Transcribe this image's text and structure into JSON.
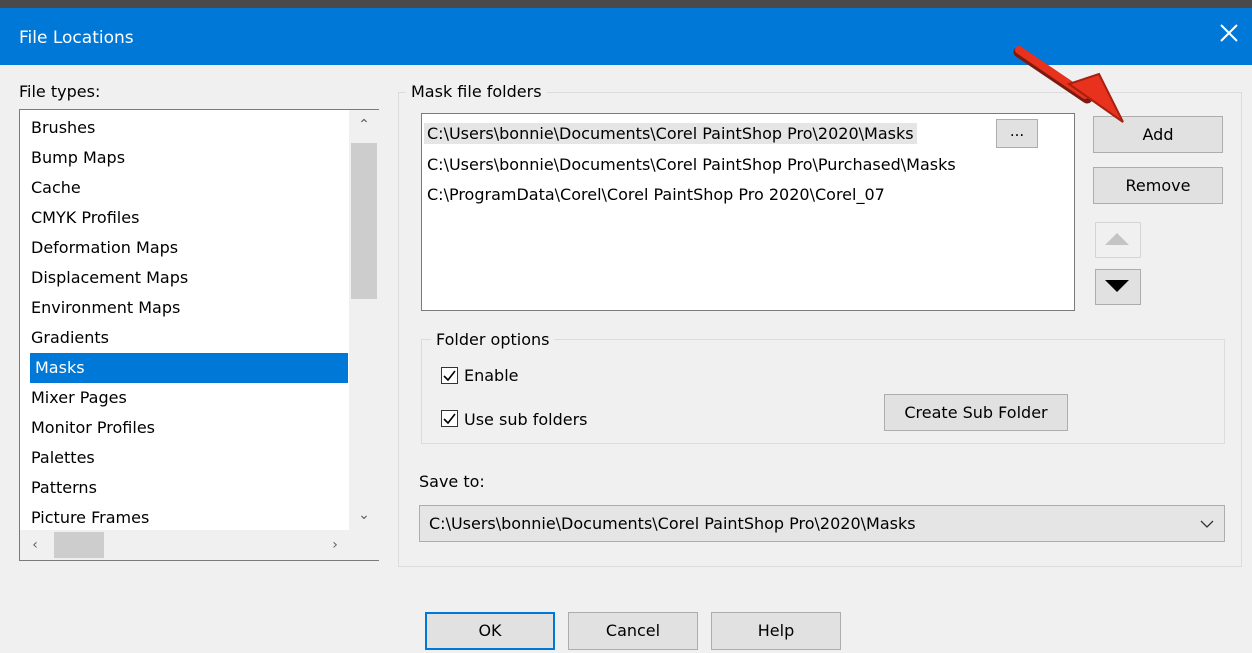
{
  "window": {
    "title": "File Locations",
    "close_icon": "close-icon"
  },
  "file_types": {
    "label": "File types:",
    "selected": "Masks",
    "items": [
      "Brushes",
      "Bump Maps",
      "Cache",
      "CMYK Profiles",
      "Deformation Maps",
      "Displacement Maps",
      "Environment Maps",
      "Gradients",
      "Masks",
      "Mixer Pages",
      "Monitor Profiles",
      "Palettes",
      "Patterns",
      "Picture Frames"
    ]
  },
  "mask_folders": {
    "label": "Mask file folders",
    "rows": [
      "C:\\Users\\bonnie\\Documents\\Corel PaintShop Pro\\2020\\Masks",
      "C:\\Users\\bonnie\\Documents\\Corel PaintShop Pro\\Purchased\\Masks",
      "C:\\ProgramData\\Corel\\Corel PaintShop Pro 2020\\Corel_07"
    ],
    "browse_label": "...",
    "add_label": "Add",
    "remove_label": "Remove"
  },
  "folder_options": {
    "label": "Folder options",
    "enable_label": "Enable",
    "enable_checked": true,
    "subfolders_label": "Use sub folders",
    "subfolders_checked": true,
    "create_label": "Create Sub Folder"
  },
  "save_to": {
    "label": "Save to:",
    "value": "C:\\Users\\bonnie\\Documents\\Corel PaintShop Pro\\2020\\Masks"
  },
  "footer": {
    "ok_label": "OK",
    "cancel_label": "Cancel",
    "help_label": "Help"
  },
  "colors": {
    "titlebar": "#0078d7",
    "selection": "#0078d7",
    "annotation_arrow": "#e8321e"
  }
}
